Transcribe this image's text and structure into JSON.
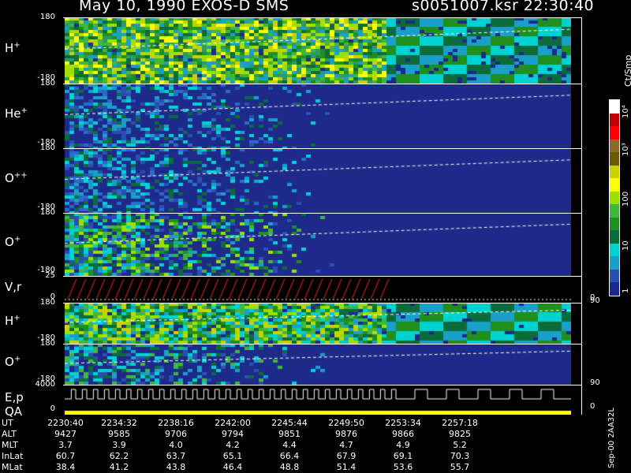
{
  "header": {
    "left_title": "May 10, 1990    EXOS-D SMS",
    "right_title": "s0051007.ksr  22:30:40"
  },
  "panels": [
    {
      "label": "H",
      "sup": "+",
      "top_tick": "180",
      "bottom_tick": "-180",
      "kind": "spectrogram",
      "palette": "green"
    },
    {
      "label": "He",
      "sup": "+",
      "top_tick": "180",
      "bottom_tick": "-180",
      "kind": "spectrogram",
      "palette": "blue"
    },
    {
      "label": "O",
      "sup": "++",
      "top_tick": "180",
      "bottom_tick": "-180",
      "kind": "spectrogram",
      "palette": "blue"
    },
    {
      "label": "O",
      "sup": "+",
      "top_tick": "180",
      "bottom_tick": "-180",
      "kind": "spectrogram",
      "palette": "mixed"
    },
    {
      "label": "V,r",
      "sup": "",
      "top_tick": "25",
      "bottom_tick": "0",
      "right_tick": "90",
      "right_bottom_tick": "0",
      "kind": "lines"
    },
    {
      "label": "H",
      "sup": "+",
      "top_tick": "180",
      "bottom_tick": "-180",
      "kind": "spectrogram",
      "palette": "stripes"
    },
    {
      "label": "O",
      "sup": "+",
      "top_tick": "180",
      "bottom_tick": "-180",
      "right_tick": "90",
      "kind": "spectrogram",
      "palette": "blue2"
    },
    {
      "label": "E,p",
      "label2": "QA",
      "sup": "",
      "top_tick": "4000",
      "bottom_tick": "0",
      "right_tick": "0",
      "kind": "steps"
    }
  ],
  "colorbar": {
    "title": "Ct/Smp",
    "ticks": [
      "10⁴",
      "10³",
      "100",
      "10",
      "1"
    ],
    "colors": [
      "#ffffff",
      "#c00000",
      "#ff0000",
      "#8c6a2b",
      "#6b5a00",
      "#c8d400",
      "#ffff00",
      "#9be000",
      "#3fb73f",
      "#1f8f1f",
      "#0b6b3b",
      "#00d2d2",
      "#19a0c8",
      "#2a4fb0",
      "#1a2a8a"
    ]
  },
  "footer": {
    "rows": [
      {
        "label": "UT",
        "values": [
          "2230:40",
          "2234:32",
          "2238:16",
          "2242:00",
          "2245:44",
          "2249:50",
          "2253:34",
          "2257:18"
        ]
      },
      {
        "label": "ALT",
        "values": [
          "9427",
          "9585",
          "9706",
          "9794",
          "9851",
          "9876",
          "9866",
          "9825"
        ]
      },
      {
        "label": "MLT",
        "values": [
          "3.7",
          "3.9",
          "4.0",
          "4.2",
          "4.4",
          "4.7",
          "4.9",
          "5.2"
        ]
      },
      {
        "label": "InLat",
        "values": [
          "60.7",
          "62.2",
          "63.7",
          "65.1",
          "66.4",
          "67.9",
          "69.1",
          "70.3"
        ]
      },
      {
        "label": "MLat",
        "values": [
          "38.4",
          "41.2",
          "43.8",
          "46.4",
          "48.8",
          "51.4",
          "53.6",
          "55.7"
        ]
      }
    ],
    "stamp": "Sep-00  2AA32L"
  }
}
